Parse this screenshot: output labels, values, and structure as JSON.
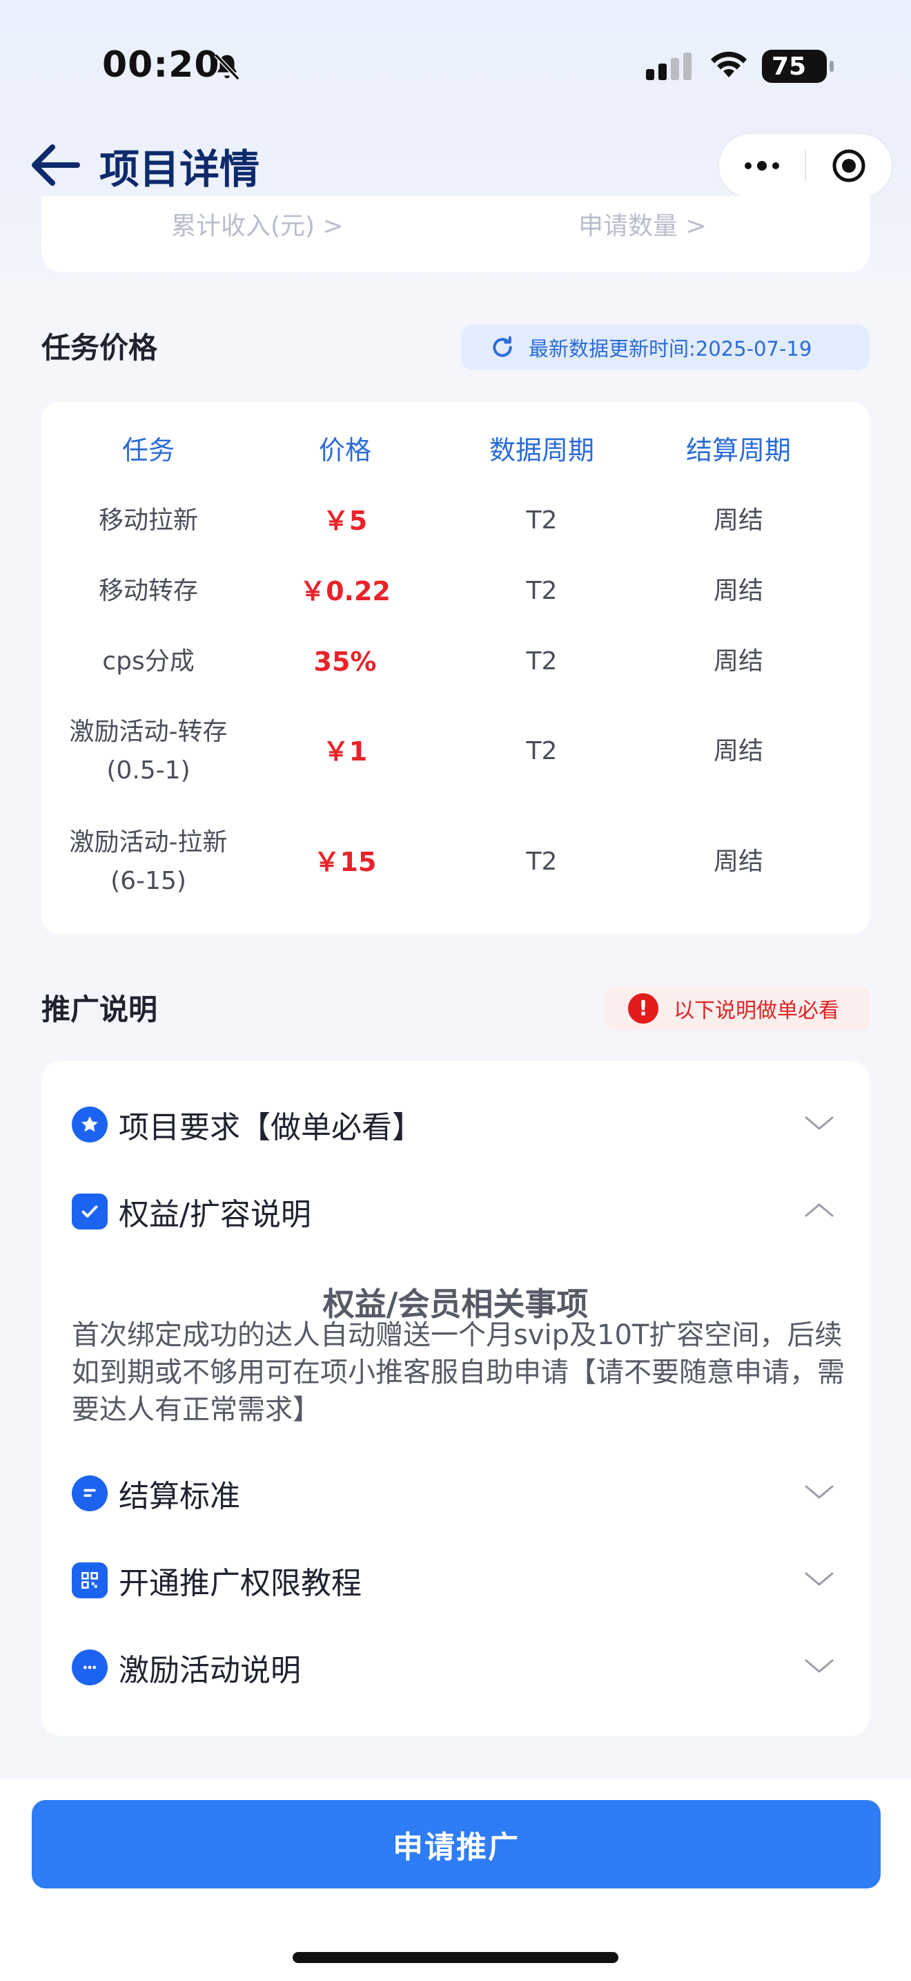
{
  "status_bar": {
    "time": "00:20",
    "battery": "75"
  },
  "nav": {
    "title": "项目详情"
  },
  "stats": {
    "total_income_label": "累计收入(元) >",
    "apply_count_label": "申请数量 >"
  },
  "task_price": {
    "title": "任务价格",
    "update_text": "最新数据更新时间:2025-07-19",
    "headers": [
      "任务",
      "价格",
      "数据周期",
      "结算周期"
    ],
    "rows": [
      {
        "task": "移动拉新",
        "price": "￥5",
        "data_cycle": "T2",
        "settle_cycle": "周结"
      },
      {
        "task": "移动转存",
        "price": "￥0.22",
        "data_cycle": "T2",
        "settle_cycle": "周结"
      },
      {
        "task": "cps分成",
        "price": "35%",
        "data_cycle": "T2",
        "settle_cycle": "周结"
      },
      {
        "task": "激励活动-转存",
        "task_sub": "(0.5-1)",
        "price": "￥1",
        "data_cycle": "T2",
        "settle_cycle": "周结"
      },
      {
        "task": "激励活动-拉新",
        "task_sub": "(6-15)",
        "price": "￥15",
        "data_cycle": "T2",
        "settle_cycle": "周结"
      }
    ]
  },
  "promo": {
    "title": "推广说明",
    "warning": "以下说明做单必看",
    "items": [
      {
        "label": "项目要求【做单必看】",
        "icon": "star-icon",
        "expanded": false
      },
      {
        "label": "权益/扩容说明",
        "icon": "check-icon",
        "expanded": true
      },
      {
        "label": "结算标准",
        "icon": "document-icon",
        "expanded": false
      },
      {
        "label": "开通推广权限教程",
        "icon": "qrcode-icon",
        "expanded": false
      },
      {
        "label": "激励活动说明",
        "icon": "chat-icon",
        "expanded": false
      }
    ],
    "expanded_title": "权益/会员相关事项",
    "expanded_text": "首次绑定成功的达人自动赠送一个月svip及10T扩容空间，后续如到期或不够用可在项小推客服自助申请【请不要随意申请，需要达人有正常需求】"
  },
  "footer": {
    "apply_button": "申请推广"
  },
  "colors": {
    "accent": "#2f7df6",
    "header_blue": "#2a6bd8",
    "price_red": "#e8232a",
    "icon_blue": "#1d63f2"
  }
}
